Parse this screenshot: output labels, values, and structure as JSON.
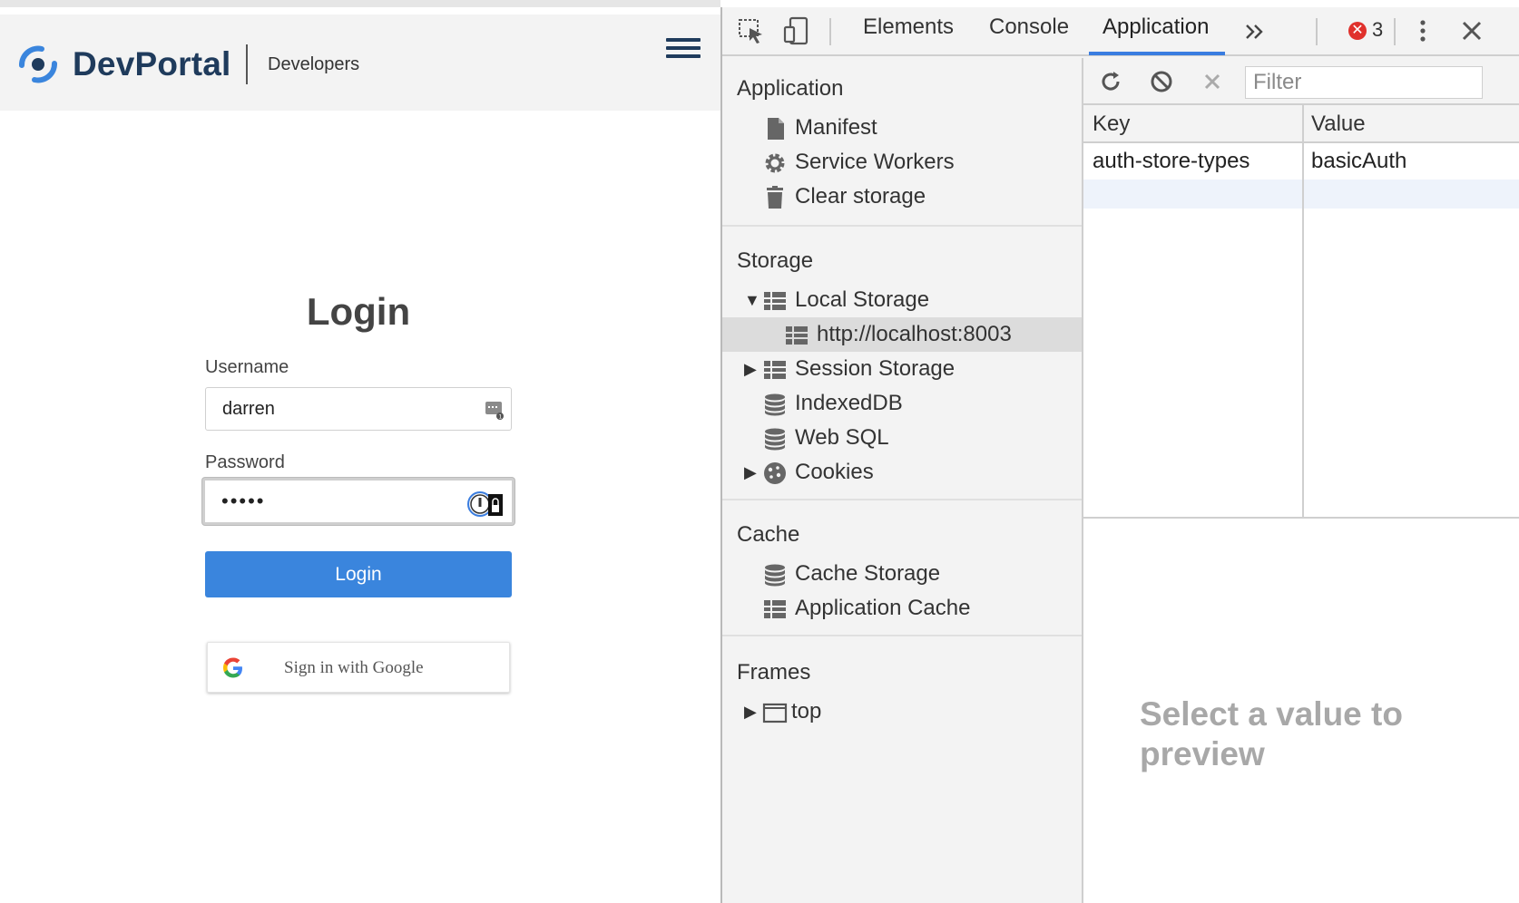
{
  "site": {
    "brand": "DevPortal",
    "subtitle": "Developers",
    "brand_color": "#1f3b5c",
    "accent_color": "#3a85dd"
  },
  "login": {
    "title": "Login",
    "username_label": "Username",
    "username_value": "darren",
    "password_label": "Password",
    "password_value": "•••••",
    "submit_label": "Login",
    "google_label": "Sign in with Google"
  },
  "devtools": {
    "tabs": [
      "Elements",
      "Console",
      "Application"
    ],
    "active_tab": "Application",
    "error_count": "3",
    "sidebar": {
      "application": {
        "title": "Application",
        "items": [
          "Manifest",
          "Service Workers",
          "Clear storage"
        ]
      },
      "storage": {
        "title": "Storage",
        "items": [
          "Local Storage",
          "http://localhost:8003",
          "Session Storage",
          "IndexedDB",
          "Web SQL",
          "Cookies"
        ],
        "selected": "http://localhost:8003"
      },
      "cache": {
        "title": "Cache",
        "items": [
          "Cache Storage",
          "Application Cache"
        ]
      },
      "frames": {
        "title": "Frames",
        "items": [
          "top"
        ]
      }
    },
    "storage_table": {
      "filter_placeholder": "Filter",
      "columns": [
        "Key",
        "Value"
      ],
      "rows": [
        {
          "key": "auth-store-types",
          "value": "basicAuth"
        }
      ],
      "preview_text": "Select a value to preview"
    }
  }
}
